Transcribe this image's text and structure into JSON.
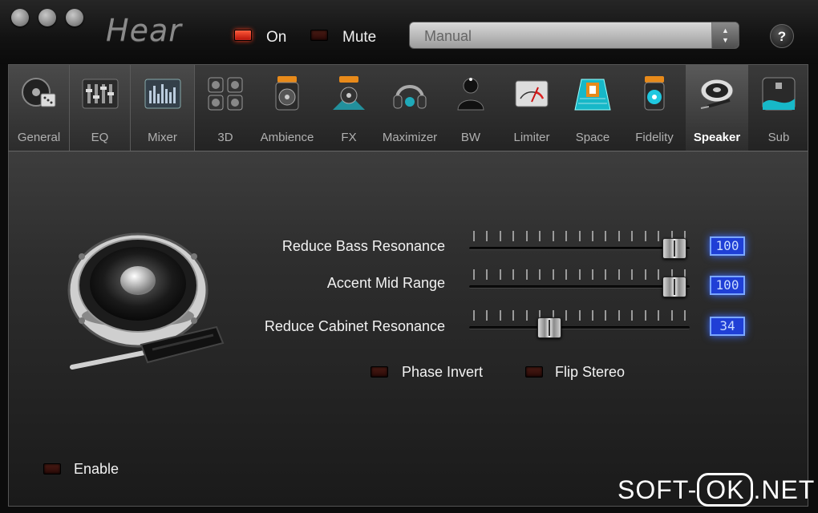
{
  "window": {
    "app_title": "Hear"
  },
  "toolbar": {
    "on_label": "On",
    "mute_label": "Mute",
    "preset_value": "Manual",
    "help_label": "?"
  },
  "tabs": [
    {
      "label": "General"
    },
    {
      "label": "EQ"
    },
    {
      "label": "Mixer"
    },
    {
      "label": "3D"
    },
    {
      "label": "Ambience"
    },
    {
      "label": "FX"
    },
    {
      "label": "Maximizer"
    },
    {
      "label": "BW"
    },
    {
      "label": "Limiter"
    },
    {
      "label": "Space"
    },
    {
      "label": "Fidelity"
    },
    {
      "label": "Speaker"
    },
    {
      "label": "Sub"
    }
  ],
  "active_tab": "Speaker",
  "speaker": {
    "sliders": [
      {
        "label": "Reduce Bass Resonance",
        "value": "100",
        "level": 1.0
      },
      {
        "label": "Accent Mid Range",
        "value": "100",
        "level": 1.0
      },
      {
        "label": "Reduce Cabinet Resonance",
        "value": "34",
        "level": 0.34
      }
    ],
    "phase_invert_label": "Phase Invert",
    "flip_stereo_label": "Flip Stereo",
    "enable_label": "Enable"
  },
  "watermark": {
    "left": "SOFT-",
    "ok": "OK",
    "right": ".NET"
  },
  "colors": {
    "led_on": "#ff3a1a",
    "value_box": "#1f3fd6",
    "background": "#1a1a1a"
  }
}
